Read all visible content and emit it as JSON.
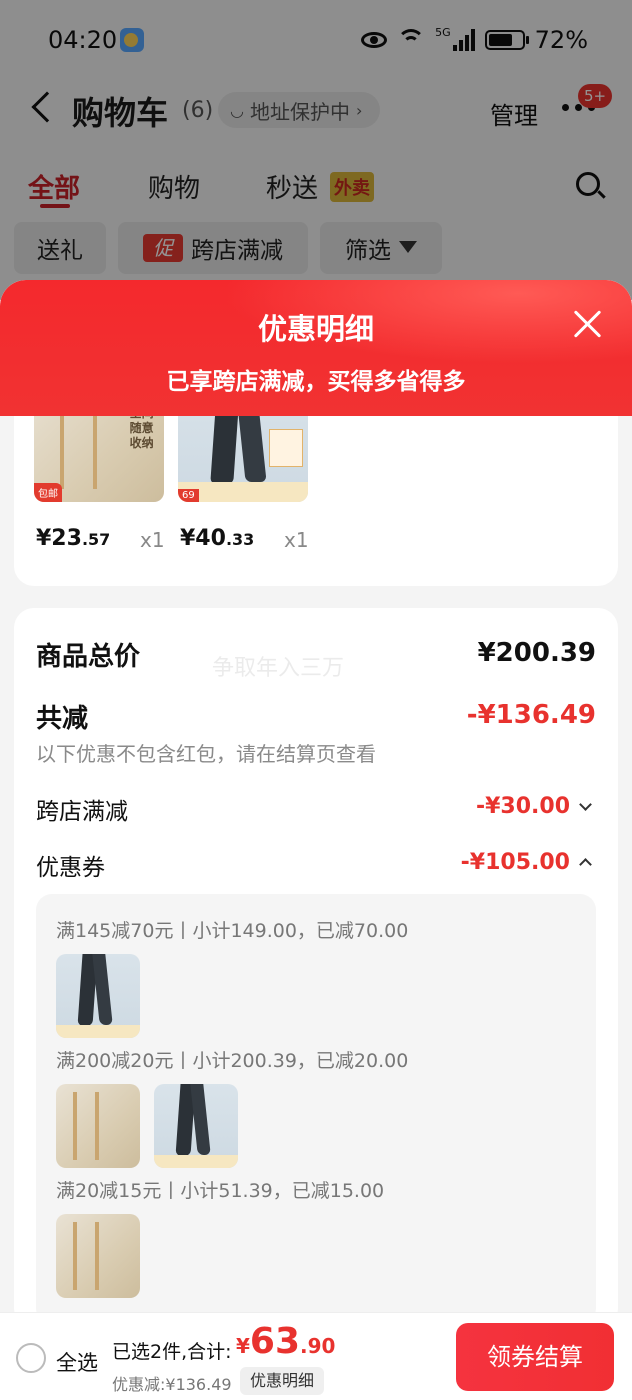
{
  "status_bar": {
    "time": "04:20",
    "network": "5G",
    "battery": "72%"
  },
  "header": {
    "title": "购物车",
    "count": "(6)",
    "address_status": "地址保护中",
    "manage": "管理",
    "badge": "5+"
  },
  "tabs": [
    {
      "label": "全部"
    },
    {
      "label": "购物"
    },
    {
      "label": "秒送"
    }
  ],
  "takeout_tag": "外卖",
  "chips": {
    "gift": "送礼",
    "promo_tag": "促",
    "cross_store": "跨店满减",
    "filter": "筛选"
  },
  "sheet": {
    "title": "优惠明细",
    "subtitle": "已享跨店满减，买得多省得多"
  },
  "products": [
    {
      "price_int": "¥23",
      "price_dec": ".57",
      "qty": "x1",
      "image_text": "不占空间随意收纳",
      "tag": "包邮"
    },
    {
      "price_int": "¥40",
      "price_dec": ".33",
      "qty": "x1",
      "tag": "69"
    }
  ],
  "summary": {
    "total_label": "商品总价",
    "total_value": "¥200.39",
    "reduce_label": "共减",
    "reduce_value": "-¥136.49",
    "note": "以下优惠不包含红包，请在结算页查看",
    "cross_store_label": "跨店满减",
    "cross_store_value": "-¥30.00",
    "coupon_label": "优惠券",
    "coupon_value": "-¥105.00",
    "watermark": "争取年入三万"
  },
  "coupons": [
    {
      "text": "满145减70元丨小计149.00，已减70.00"
    },
    {
      "text": "满200减20元丨小计200.39，已减20.00"
    },
    {
      "text": "满20减15元丨小计51.39，已减15.00"
    }
  ],
  "bottom_bar": {
    "select_all": "全选",
    "selected_summary": "已选2件,合计:",
    "total_currency": "¥",
    "total_int": "63",
    "total_dec": ".90",
    "discount_text": "优惠减:¥136.49",
    "detail_button": "优惠明细",
    "checkout": "领券结算"
  },
  "colors": {
    "accent_red": "#e8322e",
    "header_red": "#f12f33",
    "tab_active": "#c82228"
  }
}
